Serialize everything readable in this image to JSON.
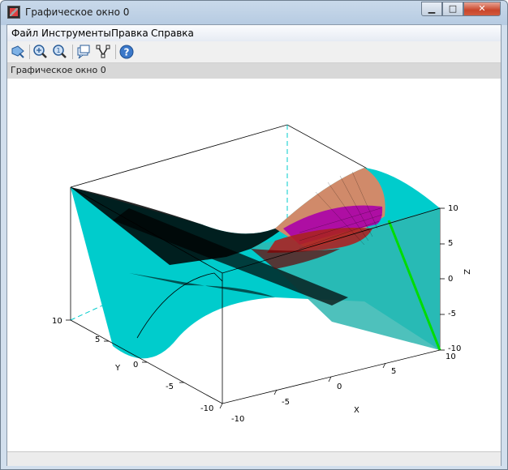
{
  "window": {
    "title": "Графическое окно 0",
    "controls": {
      "minimize": "▁",
      "maximize": "□",
      "close": "✕"
    }
  },
  "menu": [
    {
      "label": "Файл"
    },
    {
      "label": "Инструменты"
    },
    {
      "label": "Правка"
    },
    {
      "label": "Справка"
    }
  ],
  "toolbar": [
    {
      "icon": "rotate-icon",
      "name": "rotate-tool"
    },
    {
      "icon": "zoom-in-icon",
      "name": "zoom-tool"
    },
    {
      "icon": "zoom-reset-icon",
      "name": "unzoom-tool"
    },
    {
      "icon": "datatip-icon",
      "name": "datatip-tool"
    },
    {
      "icon": "datatip-edit-icon",
      "name": "datatip-edit-tool"
    },
    {
      "icon": "help-icon",
      "name": "help-tool"
    }
  ],
  "status": {
    "text": "Графическое окно 0"
  },
  "chart_data": {
    "type": "surface3d",
    "x": [
      -10,
      -5,
      0,
      5,
      10
    ],
    "y": [
      -10,
      -5,
      0,
      5,
      10
    ],
    "z_range": [
      -10,
      10
    ],
    "axes": {
      "x_label": "X",
      "y_label": "Y",
      "z_label": "Z",
      "x_ticks": [
        "-10",
        "-5",
        "0",
        "5",
        "10"
      ],
      "y_ticks": [
        "-10",
        "-5",
        "0",
        "5",
        "10"
      ],
      "z_ticks": [
        "-10",
        "-5",
        "0",
        "5",
        "10"
      ]
    },
    "colors": {
      "main": "#00cccc",
      "mesh": "#000000",
      "highlight": "#00dd00",
      "accent1": "#aa00aa",
      "accent2": "#aa2222",
      "accent3": "#d08a6a"
    }
  }
}
